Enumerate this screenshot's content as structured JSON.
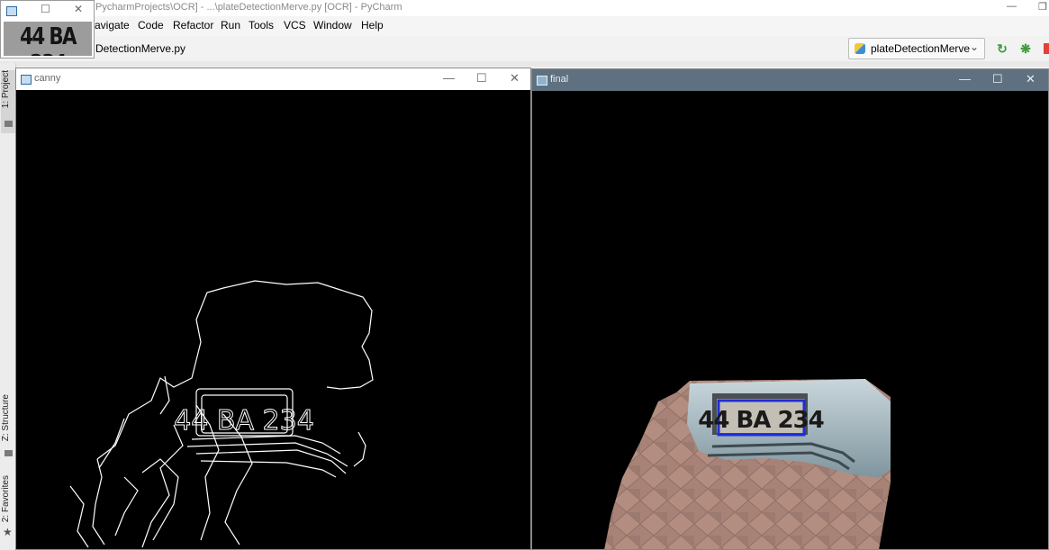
{
  "ide": {
    "window_title": "PycharmProjects\\OCR] - ...\\plateDetectionMerve.py [OCR] - PyCharm",
    "menu": [
      "avigate",
      "Code",
      "Refactor",
      "Run",
      "Tools",
      "VCS",
      "Window",
      "Help"
    ],
    "nav_file": "DetectionMerve.py",
    "run_config": "plateDetectionMerve",
    "tool_windows": {
      "project": "1: Project",
      "structure": "Z: Structure",
      "favorites": "2: Favorites"
    }
  },
  "windows": {
    "canny": {
      "title": "canny"
    },
    "final": {
      "title": "final"
    },
    "plate": {
      "plate_text": "44 BA 234"
    }
  },
  "icons": {
    "window_controls": [
      "minimize-icon",
      "maximize-icon",
      "close-icon"
    ],
    "toolbar": [
      "rerun-icon",
      "debug-bug-icon",
      "stop-icon"
    ]
  },
  "colors": {
    "detection_box": "#1e2ed6",
    "final_titlebar": "#5f7180",
    "edge_lines": "#ffffff"
  }
}
